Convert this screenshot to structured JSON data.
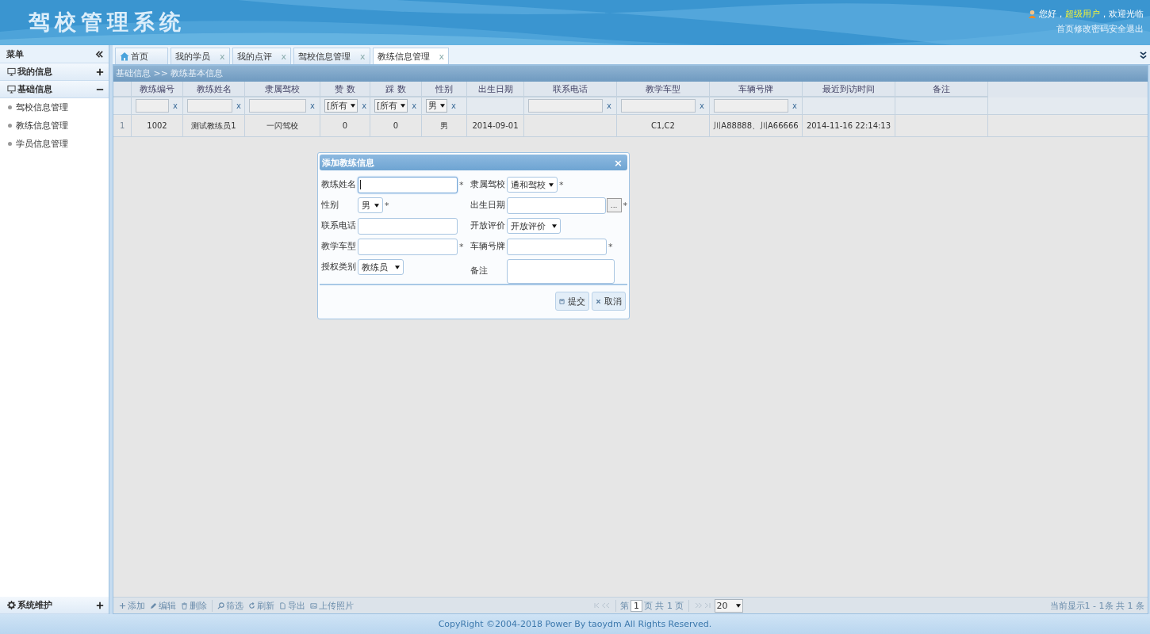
{
  "header": {
    "title": "驾校管理系统",
    "greeting": "您好，",
    "user": "超级用户",
    "welcome": "，欢迎光临",
    "links": [
      "首页",
      "修改密码",
      "安全退出"
    ]
  },
  "sidebar": {
    "title": "菜单",
    "groups": [
      {
        "label": "我的信息",
        "expanded": false
      },
      {
        "label": "基础信息",
        "expanded": true,
        "items": [
          "驾校信息管理",
          "教练信息管理",
          "学员信息管理"
        ]
      }
    ],
    "bottom_group": {
      "label": "系统维护",
      "expanded": false
    }
  },
  "tabs": [
    {
      "label": "首页",
      "kind": "home",
      "selected": false
    },
    {
      "label": "我的学员",
      "kind": "closable",
      "close": "x",
      "selected": false
    },
    {
      "label": "我的点评",
      "kind": "closable",
      "close": "x",
      "selected": false
    },
    {
      "label": "驾校信息管理",
      "kind": "closable",
      "close": "x",
      "selected": false
    },
    {
      "label": "教练信息管理",
      "kind": "closable",
      "close": "x",
      "selected": true
    }
  ],
  "breadcrumb": "基础信息 >> 教练基本信息",
  "table": {
    "columns": [
      {
        "header": "教练编号",
        "filter": {
          "kind": "text",
          "clear": "x"
        }
      },
      {
        "header": "教练姓名",
        "filter": {
          "kind": "text",
          "clear": "x"
        }
      },
      {
        "header": "隶属驾校",
        "filter": {
          "kind": "text",
          "clear": "x"
        }
      },
      {
        "header": "赞 数",
        "filter": {
          "kind": "select",
          "value": "[所有",
          "clear": "x"
        }
      },
      {
        "header": "踩 数",
        "filter": {
          "kind": "select",
          "value": "[所有",
          "clear": "x"
        }
      },
      {
        "header": "性别",
        "filter": {
          "kind": "select",
          "value": "男",
          "clear": "x"
        }
      },
      {
        "header": "出生日期"
      },
      {
        "header": "联系电话",
        "filter": {
          "kind": "text",
          "clear": "x"
        }
      },
      {
        "header": "教学车型",
        "filter": {
          "kind": "text",
          "clear": "x"
        }
      },
      {
        "header": "车辆号牌",
        "filter": {
          "kind": "text",
          "clear": "x"
        }
      },
      {
        "header": "最近到访时间"
      },
      {
        "header": "备注"
      }
    ],
    "rows": [
      {
        "number": "1",
        "cells": [
          "1002",
          "测试教练员1",
          "一闪驾校",
          "0",
          "0",
          "男",
          "2014-09-01",
          "",
          "C1,C2",
          "川A88888、川A66666",
          "2014-11-16 22:14:13",
          ""
        ]
      }
    ]
  },
  "dialog": {
    "title": "添加教练信息",
    "close": "×",
    "fields": [
      {
        "label": "教练姓名",
        "kind": "text",
        "focused": true,
        "mark": "*"
      },
      {
        "label": "隶属驾校",
        "kind": "select",
        "value": "通和驾校",
        "mark": "*"
      },
      {
        "label": "性别",
        "kind": "select",
        "value": "男",
        "mark": "*"
      },
      {
        "label": "出生日期",
        "kind": "date",
        "button": "...",
        "mark": "*"
      },
      {
        "label": "联系电话",
        "kind": "text",
        "focused": false
      },
      {
        "label": "开放评价",
        "kind": "select",
        "value": "开放评价"
      },
      {
        "label": "教学车型",
        "kind": "text",
        "focused": false,
        "mark": "*"
      },
      {
        "label": "车辆号牌",
        "kind": "text",
        "focused": false,
        "mark": "*"
      },
      {
        "label": "授权类别",
        "kind": "select",
        "value": "教练员"
      },
      {
        "label": "备注",
        "kind": "textarea"
      }
    ],
    "buttons": [
      "提交",
      "取消"
    ]
  },
  "toolbar": [
    "添加",
    "编辑",
    "删除",
    "筛选",
    "刷新",
    "导出",
    "上传照片"
  ],
  "pager": {
    "before": "第",
    "page": "1",
    "after": "页 共 1 页",
    "size": "20",
    "summary": "当前显示1 - 1条  共 1 条"
  },
  "footer": "CopyRight ©2004-2018 Power By taoydm   All Rights Reserved."
}
